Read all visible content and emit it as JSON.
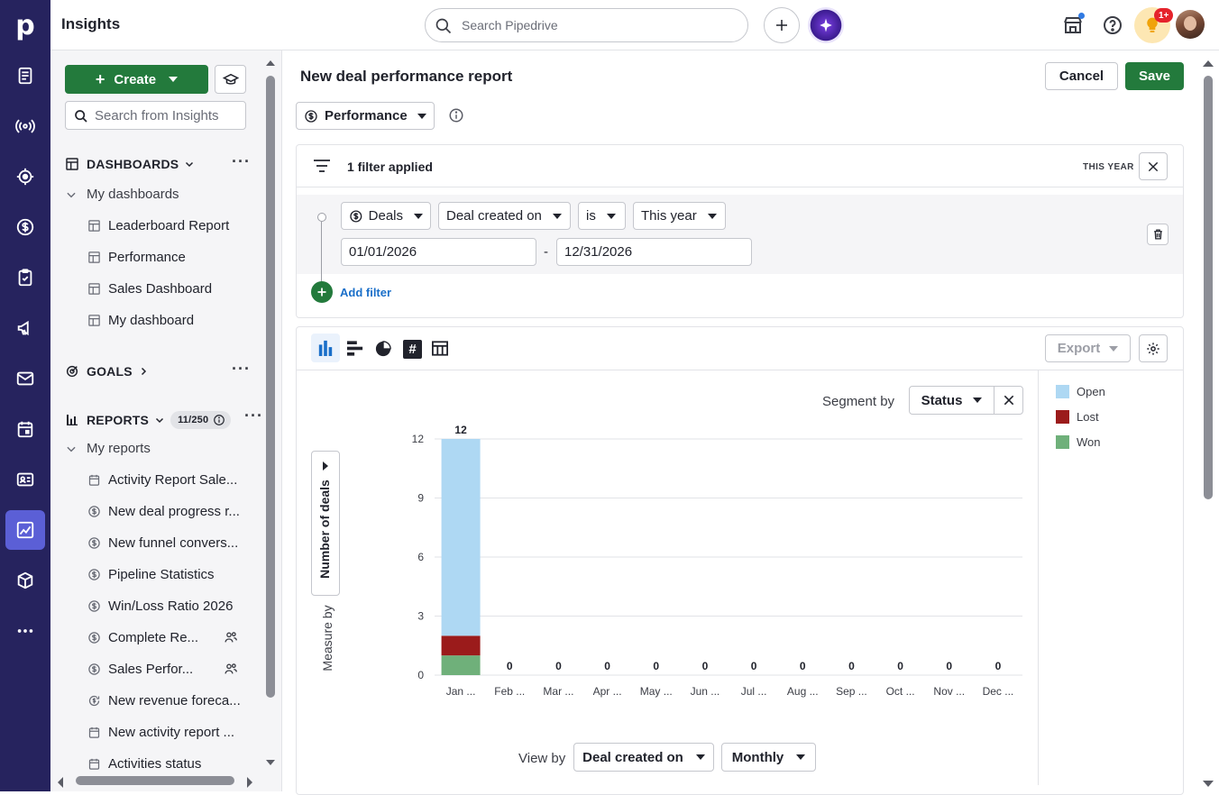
{
  "app": {
    "title": "Insights",
    "search_placeholder": "Search Pipedrive",
    "notif_badge": "1+"
  },
  "sidebar": {
    "create_label": "Create",
    "search_placeholder": "Search from Insights",
    "dashboards_label": "DASHBOARDS",
    "my_dashboards_label": "My dashboards",
    "dashboards": [
      "Leaderboard Report",
      "Performance",
      "Sales Dashboard",
      "My dashboard"
    ],
    "goals_label": "GOALS",
    "reports_label": "REPORTS",
    "reports_count": "11/250",
    "my_reports_label": "My reports",
    "reports": [
      {
        "label": "Activity Report Sale...",
        "icon": "calendar-icon",
        "shared": false
      },
      {
        "label": "New deal progress r...",
        "icon": "dollar-icon",
        "shared": false
      },
      {
        "label": "New funnel convers...",
        "icon": "dollar-icon",
        "shared": false
      },
      {
        "label": "Pipeline Statistics",
        "icon": "dollar-icon",
        "shared": false
      },
      {
        "label": "Win/Loss Ratio 2026",
        "icon": "dollar-icon",
        "shared": false
      },
      {
        "label": "Complete Re...",
        "icon": "dollar-icon",
        "shared": true
      },
      {
        "label": "Sales Perfor...",
        "icon": "dollar-icon",
        "shared": true
      },
      {
        "label": "New revenue foreca...",
        "icon": "revenue-icon",
        "shared": false
      },
      {
        "label": "New activity report ...",
        "icon": "calendar-icon",
        "shared": false
      },
      {
        "label": "Activities status",
        "icon": "calendar-icon",
        "shared": false
      }
    ]
  },
  "report": {
    "title": "New deal performance report",
    "cancel_label": "Cancel",
    "save_label": "Save",
    "type_label": "Performance",
    "filter_summary": "1 filter applied",
    "filter_period": "THIS YEAR",
    "filter": {
      "entity": "Deals",
      "field": "Deal created on",
      "operator": "is",
      "value": "This year",
      "date_from": "01/01/2026",
      "date_sep": "-",
      "date_to": "12/31/2026"
    },
    "add_filter_label": "Add filter",
    "export_label": "Export",
    "segment_by_label": "Segment by",
    "segment_value": "Status",
    "measure_by_label": "Measure by",
    "measure_value": "Number of deals",
    "view_by_label": "View by",
    "view_by_value": "Deal created on",
    "interval_value": "Monthly"
  },
  "chart_data": {
    "type": "bar",
    "stacked": true,
    "categories": [
      "Jan ...",
      "Feb ...",
      "Mar ...",
      "Apr ...",
      "May ...",
      "Jun ...",
      "Jul ...",
      "Aug ...",
      "Sep ...",
      "Oct ...",
      "Nov ...",
      "Dec ..."
    ],
    "series": [
      {
        "name": "Won",
        "color": "#6fb07a",
        "values": [
          1,
          0,
          0,
          0,
          0,
          0,
          0,
          0,
          0,
          0,
          0,
          0
        ]
      },
      {
        "name": "Lost",
        "color": "#9b1b1b",
        "values": [
          1,
          0,
          0,
          0,
          0,
          0,
          0,
          0,
          0,
          0,
          0,
          0
        ]
      },
      {
        "name": "Open",
        "color": "#aed8f3",
        "values": [
          10,
          0,
          0,
          0,
          0,
          0,
          0,
          0,
          0,
          0,
          0,
          0
        ]
      }
    ],
    "totals": [
      "12",
      "0",
      "0",
      "0",
      "0",
      "0",
      "0",
      "0",
      "0",
      "0",
      "0",
      "0"
    ],
    "ylim": [
      0,
      12
    ],
    "yticks": [
      "0",
      "3",
      "6",
      "9",
      "12"
    ],
    "legend": [
      "Open",
      "Lost",
      "Won"
    ],
    "legend_colors": [
      "#aed8f3",
      "#9b1b1b",
      "#6fb07a"
    ],
    "legend_position": "right",
    "grid": true
  }
}
